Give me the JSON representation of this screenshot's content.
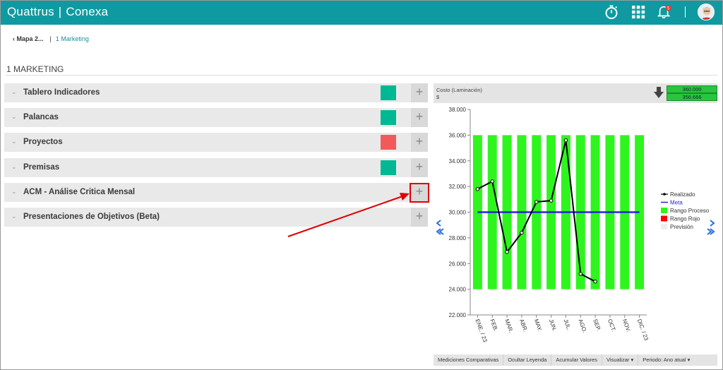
{
  "app": {
    "brand_left": "Quattrus",
    "brand_sep": "|",
    "brand_right": "Conexa",
    "notification_count": "5"
  },
  "colors": {
    "topbar": "#0e9aa0",
    "status_green": "#00b894",
    "status_red": "#f25a5a",
    "bar_green": "#2ef51e",
    "meta_line": "#2b22d8"
  },
  "breadcrumb": {
    "back_label": "Mapa 2...",
    "separator": "|",
    "current": "1 Marketing"
  },
  "page": {
    "title": "1 MARKETING"
  },
  "sections": [
    {
      "label": "Tablero Indicadores",
      "status": "green"
    },
    {
      "label": "Palancas",
      "status": "green"
    },
    {
      "label": "Proyectos",
      "status": "red"
    },
    {
      "label": "Premisas",
      "status": "green"
    },
    {
      "label": "ACM - Análise Critica Mensal",
      "status": null
    },
    {
      "label": "Presentaciones de Objetivos (Beta)",
      "status": null
    }
  ],
  "chart_panel": {
    "title": "Costo (Laminación)",
    "unit": "$",
    "value_top": "360.000",
    "value_bottom": "356.666",
    "toolbar": [
      "Mediciones Comparativas",
      "Ocultar Leyenda",
      "Acumular Valores",
      "Visualizar ▾",
      "Periodo: Ano atual ▾"
    ]
  },
  "chart_data": {
    "type": "line",
    "categories": [
      "ENE. / 23",
      "FEB.",
      "MAR.",
      "ABR.",
      "MAY.",
      "JUN.",
      "JUL.",
      "AGO.",
      "SEP.",
      "OCT.",
      "NOV.",
      "DIC. / 23"
    ],
    "ylim": [
      22000,
      38000
    ],
    "yticks": [
      "22.000",
      "24.000",
      "26.000",
      "28.000",
      "30.000",
      "32.000",
      "34.000",
      "36.000",
      "38.000"
    ],
    "series": [
      {
        "name": "Realizado",
        "values": [
          31800,
          32400,
          26900,
          28400,
          30800,
          30900,
          35600,
          25200,
          24600,
          null,
          null,
          null
        ]
      },
      {
        "name": "Meta",
        "values": [
          30000,
          30000,
          30000,
          30000,
          30000,
          30000,
          30000,
          30000,
          30000,
          30000,
          30000,
          30000
        ]
      },
      {
        "name": "Rango Proceso",
        "range": [
          24000,
          36000
        ]
      }
    ],
    "legend": [
      "Realizado",
      "Meta",
      "Rango Proceso",
      "Rango Rojo",
      "Previsión"
    ],
    "legend_placement": "right",
    "grid": false
  }
}
